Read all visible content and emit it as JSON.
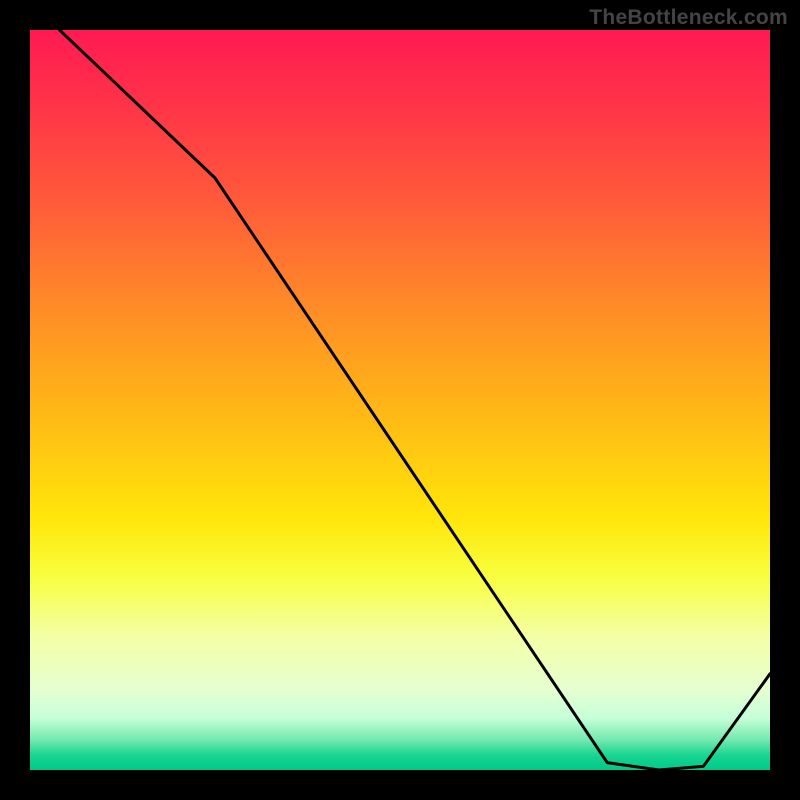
{
  "watermark": "TheBottleneck.com",
  "anchor_label": "",
  "chart_data": {
    "type": "line",
    "title": "",
    "xlabel": "",
    "ylabel": "",
    "xlim": [
      0,
      100
    ],
    "ylim": [
      0,
      100
    ],
    "x": [
      0,
      4,
      25,
      78,
      85,
      91,
      100
    ],
    "values": [
      108,
      100,
      80,
      1,
      0,
      0.5,
      13
    ],
    "background": "thermal-gradient",
    "notes": "Single black curve descending from upper-left to a minimum plateau near x≈80–90, then rising toward the right edge."
  },
  "colors": {
    "curve": "#000000",
    "watermark": "#444444",
    "anchor_text": "#d62211"
  }
}
